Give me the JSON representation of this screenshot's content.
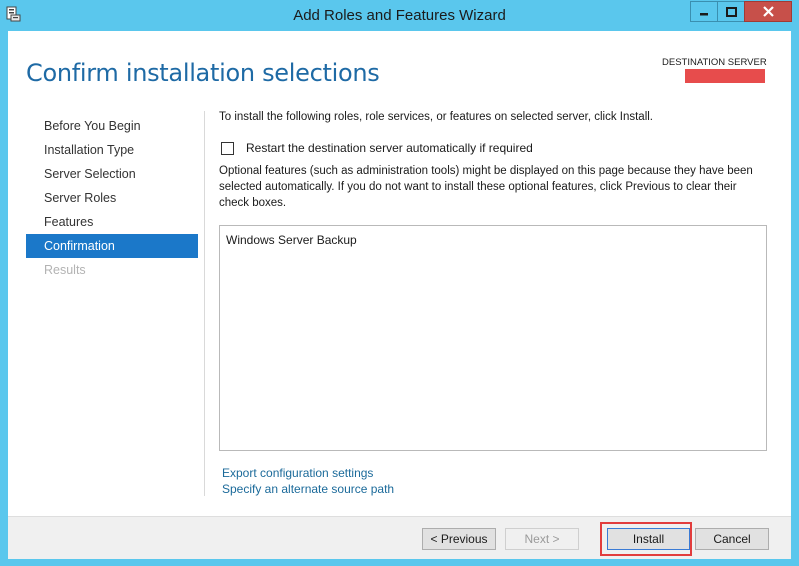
{
  "window": {
    "title": "Add Roles and Features Wizard",
    "icon": "server-manager-icon"
  },
  "header": {
    "page_title": "Confirm installation selections",
    "destination_label": "DESTINATION SERVER"
  },
  "nav": {
    "items": [
      {
        "label": "Before You Begin",
        "state": "normal"
      },
      {
        "label": "Installation Type",
        "state": "normal"
      },
      {
        "label": "Server Selection",
        "state": "normal"
      },
      {
        "label": "Server Roles",
        "state": "normal"
      },
      {
        "label": "Features",
        "state": "normal"
      },
      {
        "label": "Confirmation",
        "state": "active"
      },
      {
        "label": "Results",
        "state": "disabled"
      }
    ]
  },
  "content": {
    "intro": "To install the following roles, role services, or features on selected server, click Install.",
    "restart_checkbox": {
      "label": "Restart the destination server automatically if required",
      "checked": false
    },
    "optional_text": "Optional features (such as administration tools) might be displayed on this page because they have been selected automatically. If you do not want to install these optional features, click Previous to clear their check boxes.",
    "features": [
      "Windows Server Backup"
    ],
    "links": {
      "export": "Export configuration settings",
      "alternate_source": "Specify an alternate source path"
    }
  },
  "footer": {
    "previous_label": "< Previous",
    "next_label": "Next >",
    "install_label": "Install",
    "cancel_label": "Cancel"
  },
  "colors": {
    "title_blue": "#1e6aa5",
    "nav_active": "#1b78c9",
    "link": "#1b6a9a",
    "window_frame": "#5ac7ed",
    "close_button": "#c7504a",
    "highlight": "#e23d3d"
  }
}
